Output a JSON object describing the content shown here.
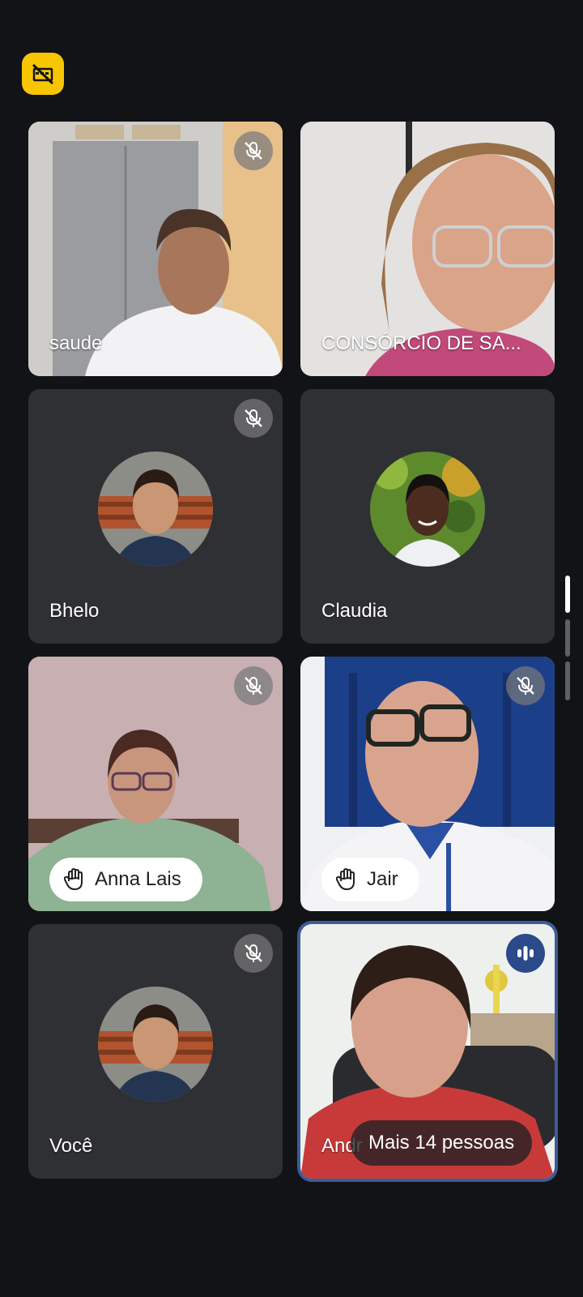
{
  "participants": [
    {
      "name": "saude",
      "muted": true
    },
    {
      "name": "CONSÓRCIO DE SA...",
      "muted": false
    },
    {
      "name": "Bhelo",
      "muted": true
    },
    {
      "name": "Claudia",
      "muted": false
    },
    {
      "name": "Anna Lais",
      "muted": true,
      "hand_raised": true
    },
    {
      "name": "Jair",
      "muted": true,
      "hand_raised": true
    },
    {
      "name": "Você",
      "muted": true
    },
    {
      "name": "Andr",
      "muted": false,
      "speaking": true
    }
  ],
  "more_people_label": "Mais 14 pessoas",
  "icons": {
    "top_badge": "video-off-icon",
    "muted": "mic-off-icon",
    "hand": "raised-hand-icon",
    "speaking": "audio-wave-icon"
  },
  "colors": {
    "background": "#121316",
    "tile": "#2f3034",
    "badge": "#f7c600",
    "speaking_accent": "#3c5c98"
  }
}
